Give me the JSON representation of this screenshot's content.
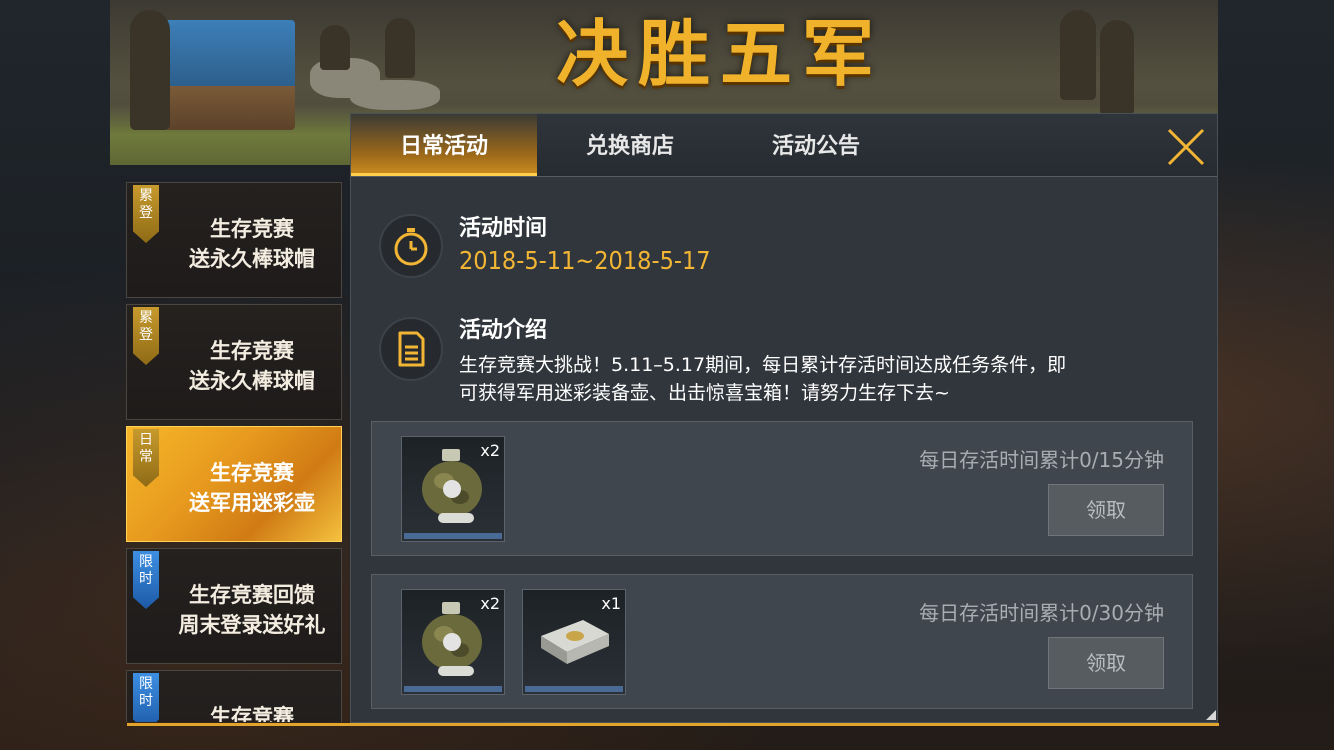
{
  "banner": {
    "title": "决胜五军"
  },
  "tabs": [
    {
      "label": "日常活动",
      "active": true
    },
    {
      "label": "兑换商店",
      "active": false
    },
    {
      "label": "活动公告",
      "active": false
    }
  ],
  "sidebar": {
    "items": [
      {
        "ribbon": "累登",
        "ribbon_color": "gold",
        "line1": "生存竞赛",
        "line2": "送永久棒球帽",
        "active": false
      },
      {
        "ribbon": "累登",
        "ribbon_color": "gold",
        "line1": "生存竞赛",
        "line2": "送永久棒球帽",
        "active": false
      },
      {
        "ribbon": "日常",
        "ribbon_color": "gold",
        "line1": "生存竞赛",
        "line2": "送军用迷彩壶",
        "active": true
      },
      {
        "ribbon": "限时",
        "ribbon_color": "blue",
        "line1": "生存竞赛回馈",
        "line2": "周末登录送好礼",
        "active": false
      },
      {
        "ribbon": "限时",
        "ribbon_color": "blue",
        "line1": "生存竞赛",
        "line2": "",
        "active": false
      }
    ]
  },
  "main": {
    "time_section": {
      "title": "活动时间",
      "value": "2018-5-11~2018-5-17",
      "icon": "stopwatch-icon"
    },
    "intro_section": {
      "title": "活动介绍",
      "text_line1": "生存竞赛大挑战！5.11–5.17期间，每日累计存活时间达成任务条件，即",
      "text_line2": "可获得军用迷彩装备壶、出击惊喜宝箱！请努力生存下去~",
      "icon": "document-icon"
    },
    "tasks": [
      {
        "description": "每日存活时间累计0/15分钟",
        "button": "领取",
        "rewards": [
          {
            "item": "camo-canteen",
            "qty": "x2"
          }
        ]
      },
      {
        "description": "每日存活时间累计0/30分钟",
        "button": "领取",
        "rewards": [
          {
            "item": "camo-canteen",
            "qty": "x2"
          },
          {
            "item": "surprise-chest",
            "qty": "x1"
          }
        ]
      }
    ]
  },
  "colors": {
    "accent": "#f2b534",
    "panel_bg": "#31363c",
    "ribbon_gold": "#c79a2d",
    "ribbon_blue": "#3d8fe3"
  }
}
